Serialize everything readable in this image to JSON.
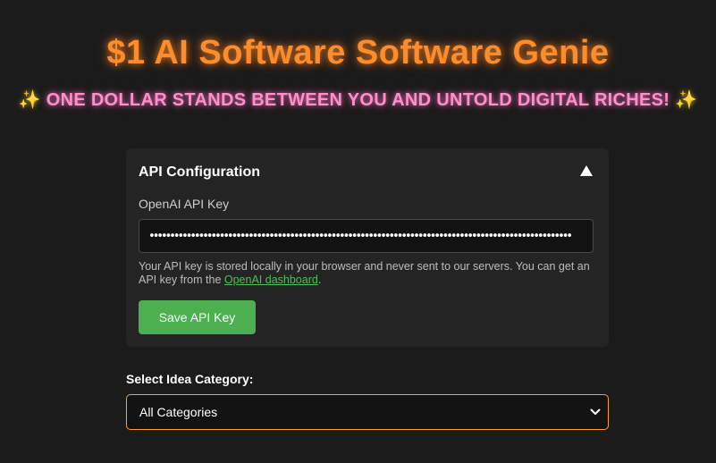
{
  "header": {
    "title": "$1 AI Software Software Genie",
    "subtitle_prefix_icon": "✨",
    "subtitle": "ONE DOLLAR STANDS BETWEEN YOU AND UNTOLD DIGITAL RICHES!",
    "subtitle_suffix_icon": "✨"
  },
  "api_config": {
    "title": "API Configuration",
    "toggle_icon": "collapse-up-icon",
    "field_label": "OpenAI API Key",
    "api_key_value": "••••••••••••••••••••••••••••••••••••••••••••••••••••••••••••••••••••••••••••••••••••••••••••••••••••••",
    "help_text_before": "Your API key is stored locally in your browser and never sent to our servers. You can get an API key from the ",
    "help_link": "OpenAI dashboard",
    "help_text_after": ".",
    "save_label": "Save API Key"
  },
  "category": {
    "label": "Select Idea Category:",
    "selected": "All Categories"
  },
  "colors": {
    "background": "#1b1b1b",
    "title": "#ff8c2a",
    "subtitle": "#ff8fcc",
    "card": "#242424",
    "button": "#4caf50",
    "link": "#4fbf5a",
    "select_border": "#ff9f2e"
  }
}
